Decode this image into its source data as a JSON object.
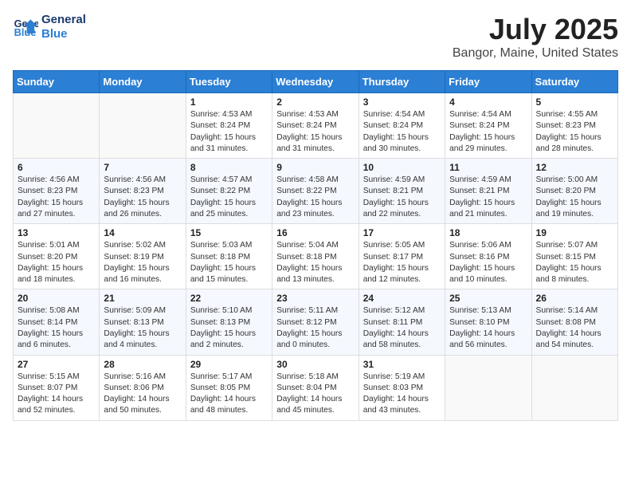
{
  "header": {
    "logo_line1": "General",
    "logo_line2": "Blue",
    "month_year": "July 2025",
    "location": "Bangor, Maine, United States"
  },
  "weekdays": [
    "Sunday",
    "Monday",
    "Tuesday",
    "Wednesday",
    "Thursday",
    "Friday",
    "Saturday"
  ],
  "weeks": [
    [
      {
        "day": "",
        "content": ""
      },
      {
        "day": "",
        "content": ""
      },
      {
        "day": "1",
        "content": "Sunrise: 4:53 AM\nSunset: 8:24 PM\nDaylight: 15 hours\nand 31 minutes."
      },
      {
        "day": "2",
        "content": "Sunrise: 4:53 AM\nSunset: 8:24 PM\nDaylight: 15 hours\nand 31 minutes."
      },
      {
        "day": "3",
        "content": "Sunrise: 4:54 AM\nSunset: 8:24 PM\nDaylight: 15 hours\nand 30 minutes."
      },
      {
        "day": "4",
        "content": "Sunrise: 4:54 AM\nSunset: 8:24 PM\nDaylight: 15 hours\nand 29 minutes."
      },
      {
        "day": "5",
        "content": "Sunrise: 4:55 AM\nSunset: 8:23 PM\nDaylight: 15 hours\nand 28 minutes."
      }
    ],
    [
      {
        "day": "6",
        "content": "Sunrise: 4:56 AM\nSunset: 8:23 PM\nDaylight: 15 hours\nand 27 minutes."
      },
      {
        "day": "7",
        "content": "Sunrise: 4:56 AM\nSunset: 8:23 PM\nDaylight: 15 hours\nand 26 minutes."
      },
      {
        "day": "8",
        "content": "Sunrise: 4:57 AM\nSunset: 8:22 PM\nDaylight: 15 hours\nand 25 minutes."
      },
      {
        "day": "9",
        "content": "Sunrise: 4:58 AM\nSunset: 8:22 PM\nDaylight: 15 hours\nand 23 minutes."
      },
      {
        "day": "10",
        "content": "Sunrise: 4:59 AM\nSunset: 8:21 PM\nDaylight: 15 hours\nand 22 minutes."
      },
      {
        "day": "11",
        "content": "Sunrise: 4:59 AM\nSunset: 8:21 PM\nDaylight: 15 hours\nand 21 minutes."
      },
      {
        "day": "12",
        "content": "Sunrise: 5:00 AM\nSunset: 8:20 PM\nDaylight: 15 hours\nand 19 minutes."
      }
    ],
    [
      {
        "day": "13",
        "content": "Sunrise: 5:01 AM\nSunset: 8:20 PM\nDaylight: 15 hours\nand 18 minutes."
      },
      {
        "day": "14",
        "content": "Sunrise: 5:02 AM\nSunset: 8:19 PM\nDaylight: 15 hours\nand 16 minutes."
      },
      {
        "day": "15",
        "content": "Sunrise: 5:03 AM\nSunset: 8:18 PM\nDaylight: 15 hours\nand 15 minutes."
      },
      {
        "day": "16",
        "content": "Sunrise: 5:04 AM\nSunset: 8:18 PM\nDaylight: 15 hours\nand 13 minutes."
      },
      {
        "day": "17",
        "content": "Sunrise: 5:05 AM\nSunset: 8:17 PM\nDaylight: 15 hours\nand 12 minutes."
      },
      {
        "day": "18",
        "content": "Sunrise: 5:06 AM\nSunset: 8:16 PM\nDaylight: 15 hours\nand 10 minutes."
      },
      {
        "day": "19",
        "content": "Sunrise: 5:07 AM\nSunset: 8:15 PM\nDaylight: 15 hours\nand 8 minutes."
      }
    ],
    [
      {
        "day": "20",
        "content": "Sunrise: 5:08 AM\nSunset: 8:14 PM\nDaylight: 15 hours\nand 6 minutes."
      },
      {
        "day": "21",
        "content": "Sunrise: 5:09 AM\nSunset: 8:13 PM\nDaylight: 15 hours\nand 4 minutes."
      },
      {
        "day": "22",
        "content": "Sunrise: 5:10 AM\nSunset: 8:13 PM\nDaylight: 15 hours\nand 2 minutes."
      },
      {
        "day": "23",
        "content": "Sunrise: 5:11 AM\nSunset: 8:12 PM\nDaylight: 15 hours\nand 0 minutes."
      },
      {
        "day": "24",
        "content": "Sunrise: 5:12 AM\nSunset: 8:11 PM\nDaylight: 14 hours\nand 58 minutes."
      },
      {
        "day": "25",
        "content": "Sunrise: 5:13 AM\nSunset: 8:10 PM\nDaylight: 14 hours\nand 56 minutes."
      },
      {
        "day": "26",
        "content": "Sunrise: 5:14 AM\nSunset: 8:08 PM\nDaylight: 14 hours\nand 54 minutes."
      }
    ],
    [
      {
        "day": "27",
        "content": "Sunrise: 5:15 AM\nSunset: 8:07 PM\nDaylight: 14 hours\nand 52 minutes."
      },
      {
        "day": "28",
        "content": "Sunrise: 5:16 AM\nSunset: 8:06 PM\nDaylight: 14 hours\nand 50 minutes."
      },
      {
        "day": "29",
        "content": "Sunrise: 5:17 AM\nSunset: 8:05 PM\nDaylight: 14 hours\nand 48 minutes."
      },
      {
        "day": "30",
        "content": "Sunrise: 5:18 AM\nSunset: 8:04 PM\nDaylight: 14 hours\nand 45 minutes."
      },
      {
        "day": "31",
        "content": "Sunrise: 5:19 AM\nSunset: 8:03 PM\nDaylight: 14 hours\nand 43 minutes."
      },
      {
        "day": "",
        "content": ""
      },
      {
        "day": "",
        "content": ""
      }
    ]
  ]
}
